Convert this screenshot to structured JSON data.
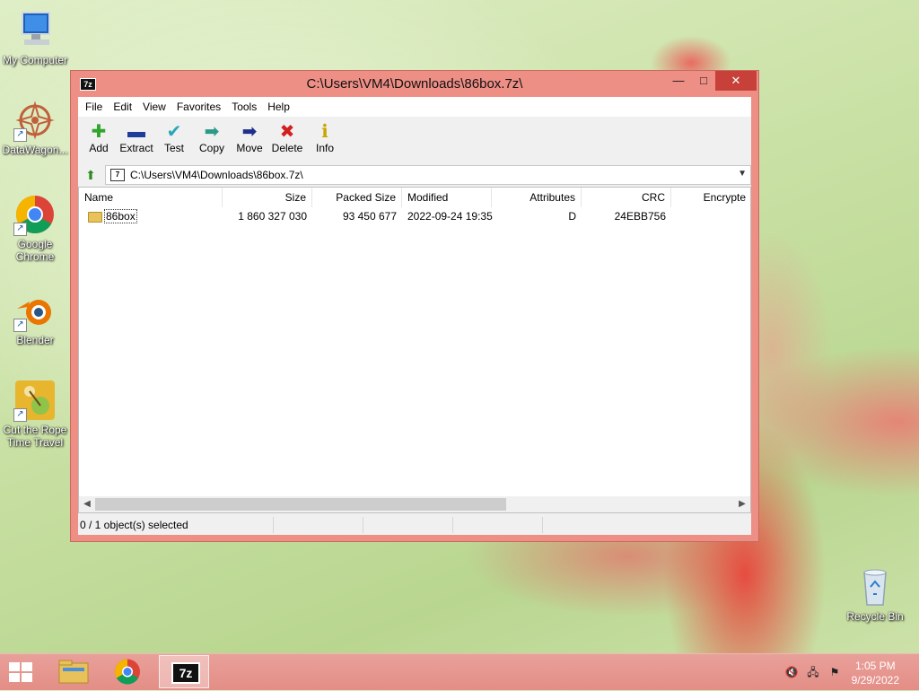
{
  "desktop": {
    "icons": [
      {
        "label": "My Computer",
        "icon": "computer-icon",
        "shortcut": false
      },
      {
        "label": "DataWagon...",
        "icon": "datawagon-icon",
        "shortcut": true
      },
      {
        "label": "Google Chrome",
        "icon": "chrome-icon",
        "shortcut": true
      },
      {
        "label": "Blender",
        "icon": "blender-icon",
        "shortcut": true
      },
      {
        "label": "Cut the Rope Time Travel",
        "icon": "cut-the-rope-icon",
        "shortcut": true
      },
      {
        "label": "Recycle Bin",
        "icon": "recycle-bin-icon",
        "shortcut": false
      }
    ]
  },
  "window": {
    "title": "C:\\Users\\VM4\\Downloads\\86box.7z\\",
    "app_icon_text": "7z",
    "controls": {
      "minimize": "—",
      "maximize": "□",
      "close": "✕"
    },
    "menu": [
      "File",
      "Edit",
      "View",
      "Favorites",
      "Tools",
      "Help"
    ],
    "toolbar": [
      {
        "label": "Add",
        "icon": "plus-icon",
        "glyph": "✚",
        "color": "#2fa52c"
      },
      {
        "label": "Extract",
        "icon": "minus-icon",
        "glyph": "▬",
        "color": "#1e3c9a"
      },
      {
        "label": "Test",
        "icon": "check-icon",
        "glyph": "✔",
        "color": "#27a7b8"
      },
      {
        "label": "Copy",
        "icon": "copy-arrow-icon",
        "glyph": "➡",
        "color": "#2b9a8a"
      },
      {
        "label": "Move",
        "icon": "move-arrow-icon",
        "glyph": "➡",
        "color": "#1f2f8c"
      },
      {
        "label": "Delete",
        "icon": "delete-x-icon",
        "glyph": "✖",
        "color": "#d21f1f"
      },
      {
        "label": "Info",
        "icon": "info-icon",
        "glyph": "ℹ",
        "color": "#c9a400"
      }
    ],
    "address": {
      "path": "C:\\Users\\VM4\\Downloads\\86box.7z\\",
      "icon_text": "7"
    },
    "columns": [
      "Name",
      "Size",
      "Packed Size",
      "Modified",
      "Attributes",
      "CRC",
      "Encrypte"
    ],
    "rows": [
      {
        "name": "86box",
        "size": "1 860 327 030",
        "packed": "93 450 677",
        "modified": "2022-09-24 19:35",
        "attributes": "D",
        "crc": "24EBB756",
        "encrypted": ""
      }
    ],
    "status": {
      "selected": "0 / 1 object(s) selected"
    }
  },
  "taskbar": {
    "pinned": [
      {
        "name": "file-explorer",
        "icon": "folder-icon"
      },
      {
        "name": "chrome",
        "icon": "chrome-icon"
      },
      {
        "name": "7zip",
        "icon": "7zip-icon",
        "text": "7z",
        "active": true
      }
    ],
    "clock": {
      "time": "1:05 PM",
      "date": "9/29/2022"
    }
  }
}
